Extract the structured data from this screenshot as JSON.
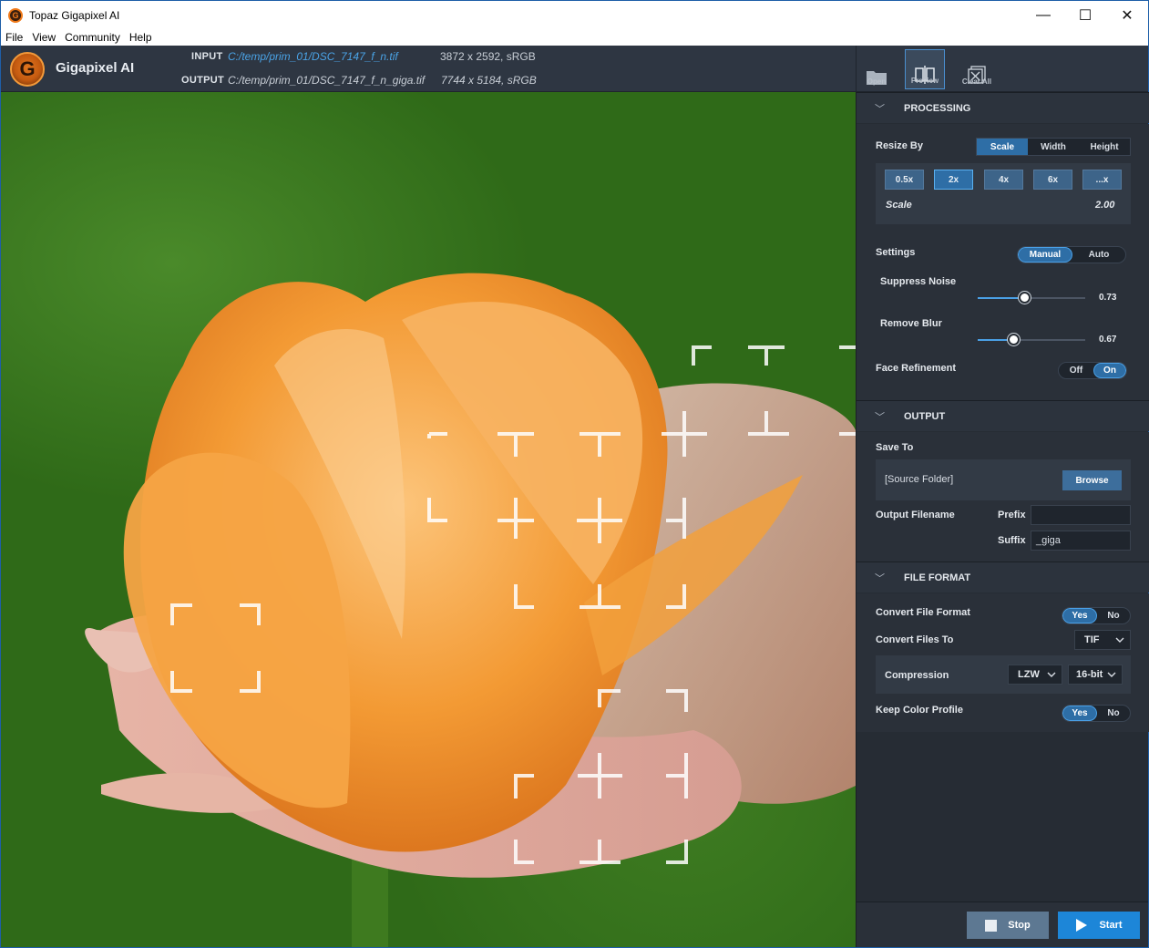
{
  "window": {
    "title": "Topaz Gigapixel AI",
    "minimize": "—",
    "maximize": "☐",
    "close": "✕"
  },
  "menu": [
    "File",
    "View",
    "Community",
    "Help"
  ],
  "header": {
    "brand": "Gigapixel AI",
    "logo_letter": "G",
    "input_label": "INPUT",
    "input_path": "C:/temp/prim_01/DSC_7147_f_n.tif",
    "input_dims": "3872 x 2592, sRGB",
    "output_label": "OUTPUT",
    "output_path": "C:/temp/prim_01/DSC_7147_f_n_giga.tif",
    "output_dims": "7744 x 5184, sRGB"
  },
  "toolbar": {
    "open": "Open",
    "preview": "Preview",
    "clear_all": "Clear All"
  },
  "processing": {
    "title": "PROCESSING",
    "resize_by_label": "Resize By",
    "resize_tabs": [
      "Scale",
      "Width",
      "Height"
    ],
    "scale_chips": [
      "0.5x",
      "2x",
      "4x",
      "6x",
      "...x"
    ],
    "scale_label": "Scale",
    "scale_value": "2.00",
    "settings_label": "Settings",
    "settings_modes": [
      "Manual",
      "Auto"
    ],
    "suppress_noise_label": "Suppress Noise",
    "suppress_noise_value": "0.73",
    "remove_blur_label": "Remove Blur",
    "remove_blur_value": "0.67",
    "face_refinement_label": "Face Refinement",
    "face_modes": [
      "Off",
      "On"
    ]
  },
  "output": {
    "title": "OUTPUT",
    "save_to_label": "Save To",
    "folder": "[Source Folder]",
    "browse": "Browse",
    "filename_label": "Output Filename",
    "prefix_label": "Prefix",
    "prefix_value": "",
    "suffix_label": "Suffix",
    "suffix_value": "_giga"
  },
  "file_format": {
    "title": "FILE FORMAT",
    "convert_label": "Convert File Format",
    "convert_modes": [
      "Yes",
      "No"
    ],
    "convert_to_label": "Convert Files To",
    "convert_to_value": "TIF",
    "compression_label": "Compression",
    "compression_value": "LZW",
    "bit_depth_value": "16-bit",
    "keep_profile_label": "Keep Color Profile",
    "keep_profile_modes": [
      "Yes",
      "No"
    ]
  },
  "footer": {
    "stop": "Stop",
    "start": "Start"
  },
  "colors": {
    "accent": "#2e6ea6",
    "start_button": "#1d86d8",
    "stop_button": "#5d7892",
    "panel": "#262c34"
  }
}
